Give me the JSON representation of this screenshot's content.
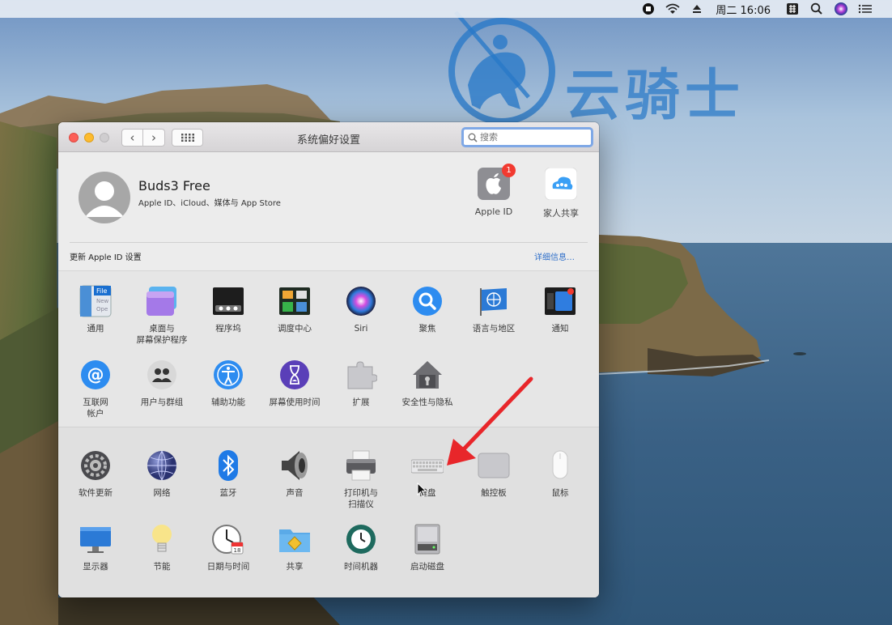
{
  "menubar": {
    "clock": "周二 16:06",
    "icons": [
      "record-icon",
      "wifi-icon",
      "eject-icon",
      "input-method-icon",
      "search-icon",
      "siri-icon",
      "control-center-icon"
    ]
  },
  "watermark": {
    "text": "云骑士"
  },
  "window": {
    "title": "系统偏好设置",
    "search_placeholder": "搜索"
  },
  "account": {
    "name": "Buds3 Free",
    "subtitle": "Apple ID、iCloud、媒体与 App Store",
    "apple_id_label": "Apple ID",
    "apple_id_badge": "1",
    "family_label": "家人共享",
    "update_text": "更新 Apple ID 设置",
    "details_link": "详细信息…"
  },
  "section1": [
    {
      "label": "通用"
    },
    {
      "label": "桌面与\n屏幕保护程序"
    },
    {
      "label": "程序坞"
    },
    {
      "label": "调度中心"
    },
    {
      "label": "Siri"
    },
    {
      "label": "聚焦"
    },
    {
      "label": "语言与地区"
    },
    {
      "label": "通知"
    },
    {
      "label": "互联网\n帐户"
    },
    {
      "label": "用户与群组"
    },
    {
      "label": "辅助功能"
    },
    {
      "label": "屏幕使用时间"
    },
    {
      "label": "扩展"
    },
    {
      "label": "安全性与隐私"
    }
  ],
  "section2": [
    {
      "label": "软件更新"
    },
    {
      "label": "网络"
    },
    {
      "label": "蓝牙"
    },
    {
      "label": "声音"
    },
    {
      "label": "打印机与\n扫描仪"
    },
    {
      "label": "键盘"
    },
    {
      "label": "触控板"
    },
    {
      "label": "鼠标"
    },
    {
      "label": "显示器"
    },
    {
      "label": "节能"
    },
    {
      "label": "日期与时间"
    },
    {
      "label": "共享"
    },
    {
      "label": "时间机器"
    },
    {
      "label": "启动磁盘"
    }
  ],
  "colors": {
    "accent": "#2f6fc9",
    "badge": "#f23a30",
    "arrow": "#e8262a"
  }
}
